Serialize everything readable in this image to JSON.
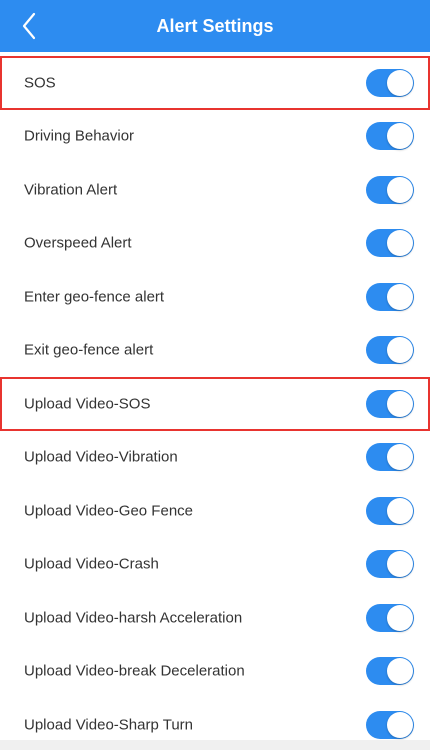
{
  "header": {
    "title": "Alert Settings",
    "back_icon": "chevron-left-icon",
    "background": "#2d8cf0"
  },
  "toggle_on_color": "#2d8cf0",
  "highlight_color": "#e8342f",
  "items": [
    {
      "label": "SOS",
      "enabled": true,
      "highlighted": true
    },
    {
      "label": "Driving Behavior",
      "enabled": true,
      "highlighted": false
    },
    {
      "label": "Vibration Alert",
      "enabled": true,
      "highlighted": false
    },
    {
      "label": "Overspeed Alert",
      "enabled": true,
      "highlighted": false
    },
    {
      "label": "Enter geo-fence alert",
      "enabled": true,
      "highlighted": false
    },
    {
      "label": "Exit geo-fence alert",
      "enabled": true,
      "highlighted": false
    },
    {
      "label": "Upload Video-SOS",
      "enabled": true,
      "highlighted": true
    },
    {
      "label": "Upload Video-Vibration",
      "enabled": true,
      "highlighted": false
    },
    {
      "label": "Upload Video-Geo Fence",
      "enabled": true,
      "highlighted": false
    },
    {
      "label": "Upload Video-Crash",
      "enabled": true,
      "highlighted": false
    },
    {
      "label": "Upload Video-harsh Acceleration",
      "enabled": true,
      "highlighted": false
    },
    {
      "label": "Upload Video-break Deceleration",
      "enabled": true,
      "highlighted": false
    },
    {
      "label": "Upload Video-Sharp Turn",
      "enabled": true,
      "highlighted": false
    }
  ]
}
